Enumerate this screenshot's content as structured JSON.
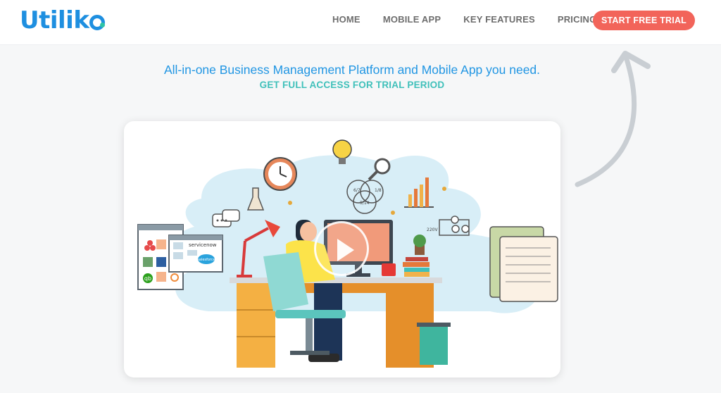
{
  "header": {
    "logo_text": "Utilik",
    "nav": [
      {
        "label": "HOME"
      },
      {
        "label": "MOBILE APP"
      },
      {
        "label": "KEY FEATURES"
      },
      {
        "label": "PRICING"
      }
    ],
    "cta_label": "START FREE TRIAL"
  },
  "hero": {
    "headline": "All-in-one Business Management Platform and Mobile App you need.",
    "subheadline": "GET FULL ACCESS FOR TRIAL PERIOD"
  },
  "illustration": {
    "integration_labels": {
      "servicenow": "servicenow",
      "salesforce": "salesforce",
      "quickbooks": "qb"
    },
    "venn_labels": [
      "6/7",
      "1/8",
      "5/14"
    ],
    "circuit_label": "220V"
  },
  "colors": {
    "brand_blue": "#1e8fe0",
    "teal": "#3fc0ba",
    "cta": "#f2645a",
    "blob": "#d8eef7",
    "desk": "#e58f2a"
  }
}
